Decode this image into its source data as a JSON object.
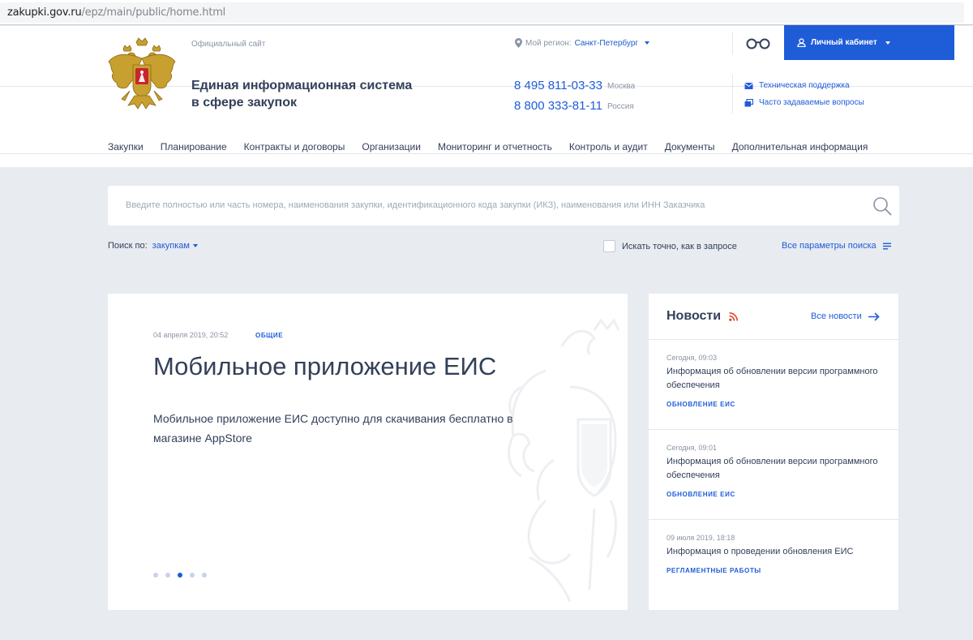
{
  "browser": {
    "url_host": "zakupki.gov.ru",
    "url_path": "/epz/main/public/home.html"
  },
  "header": {
    "official": "Официальный сайт",
    "title_line1": "Единая информационная система",
    "title_line2": "в сфере закупок",
    "region_label": "Мой регион:",
    "region_value": "Санкт-Петербург",
    "cabinet_label": "Личный кабинет",
    "phones": [
      {
        "number": "8 495 811-03-33",
        "city": "Москва"
      },
      {
        "number": "8 800 333-81-11",
        "city": "Россия"
      }
    ],
    "support_links": [
      "Техническая поддержка",
      "Часто задаваемые вопросы"
    ]
  },
  "nav": {
    "items": [
      "Закупки",
      "Планирование",
      "Контракты и договоры",
      "Организации",
      "Мониторинг и отчетность",
      "Контроль и аудит",
      "Документы",
      "Дополнительная информация"
    ]
  },
  "search": {
    "placeholder": "Введите полностью или часть номера, наименования закупки, идентификационного кода закупки (ИКЗ), наименования или ИНН Заказчика",
    "search_by_label": "Поиск по:",
    "search_by_value": "закупкам",
    "exact_label": "Искать точно, как в запросе",
    "all_params_label": "Все параметры поиска"
  },
  "slide": {
    "date": "04 апреля 2019, 20:52",
    "category": "ОБЩИЕ",
    "heading": "Мобильное приложение ЕИС",
    "body": "Мобильное приложение ЕИС доступно для скачивания бесплатно в магазине AppStore",
    "dots_total": 5,
    "dots_active": 3
  },
  "news": {
    "title": "Новости",
    "all_label": "Все новости",
    "items": [
      {
        "date": "Сегодня, 09:03",
        "title": "Информация об обновлении версии программного обеспечения",
        "tag": "ОБНОВЛЕНИЕ ЕИС"
      },
      {
        "date": "Сегодня, 09:01",
        "title": "Информация об обновлении версии программного обеспечения",
        "tag": "ОБНОВЛЕНИЕ ЕИС"
      },
      {
        "date": "09 июля 2019, 18:18",
        "title": "Информация о проведении обновления ЕИС",
        "tag": "РЕГЛАМЕНТНЫЕ РАБОТЫ"
      }
    ]
  },
  "colors": {
    "accent": "#1f5cd8",
    "text": "#334059",
    "muted": "#8a94a6",
    "background": "#e8ebf0",
    "rss": "#e0452a"
  }
}
